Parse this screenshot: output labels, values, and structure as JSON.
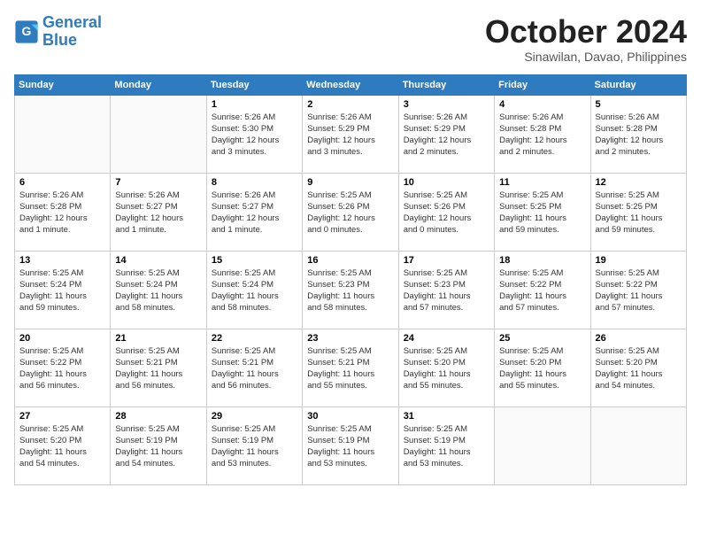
{
  "header": {
    "logo_line1": "General",
    "logo_line2": "Blue",
    "title": "October 2024",
    "location": "Sinawilan, Davao, Philippines"
  },
  "days_of_week": [
    "Sunday",
    "Monday",
    "Tuesday",
    "Wednesday",
    "Thursday",
    "Friday",
    "Saturday"
  ],
  "weeks": [
    [
      {
        "day": "",
        "info": ""
      },
      {
        "day": "",
        "info": ""
      },
      {
        "day": "1",
        "info": "Sunrise: 5:26 AM\nSunset: 5:30 PM\nDaylight: 12 hours\nand 3 minutes."
      },
      {
        "day": "2",
        "info": "Sunrise: 5:26 AM\nSunset: 5:29 PM\nDaylight: 12 hours\nand 3 minutes."
      },
      {
        "day": "3",
        "info": "Sunrise: 5:26 AM\nSunset: 5:29 PM\nDaylight: 12 hours\nand 2 minutes."
      },
      {
        "day": "4",
        "info": "Sunrise: 5:26 AM\nSunset: 5:28 PM\nDaylight: 12 hours\nand 2 minutes."
      },
      {
        "day": "5",
        "info": "Sunrise: 5:26 AM\nSunset: 5:28 PM\nDaylight: 12 hours\nand 2 minutes."
      }
    ],
    [
      {
        "day": "6",
        "info": "Sunrise: 5:26 AM\nSunset: 5:28 PM\nDaylight: 12 hours\nand 1 minute."
      },
      {
        "day": "7",
        "info": "Sunrise: 5:26 AM\nSunset: 5:27 PM\nDaylight: 12 hours\nand 1 minute."
      },
      {
        "day": "8",
        "info": "Sunrise: 5:26 AM\nSunset: 5:27 PM\nDaylight: 12 hours\nand 1 minute."
      },
      {
        "day": "9",
        "info": "Sunrise: 5:25 AM\nSunset: 5:26 PM\nDaylight: 12 hours\nand 0 minutes."
      },
      {
        "day": "10",
        "info": "Sunrise: 5:25 AM\nSunset: 5:26 PM\nDaylight: 12 hours\nand 0 minutes."
      },
      {
        "day": "11",
        "info": "Sunrise: 5:25 AM\nSunset: 5:25 PM\nDaylight: 11 hours\nand 59 minutes."
      },
      {
        "day": "12",
        "info": "Sunrise: 5:25 AM\nSunset: 5:25 PM\nDaylight: 11 hours\nand 59 minutes."
      }
    ],
    [
      {
        "day": "13",
        "info": "Sunrise: 5:25 AM\nSunset: 5:24 PM\nDaylight: 11 hours\nand 59 minutes."
      },
      {
        "day": "14",
        "info": "Sunrise: 5:25 AM\nSunset: 5:24 PM\nDaylight: 11 hours\nand 58 minutes."
      },
      {
        "day": "15",
        "info": "Sunrise: 5:25 AM\nSunset: 5:24 PM\nDaylight: 11 hours\nand 58 minutes."
      },
      {
        "day": "16",
        "info": "Sunrise: 5:25 AM\nSunset: 5:23 PM\nDaylight: 11 hours\nand 58 minutes."
      },
      {
        "day": "17",
        "info": "Sunrise: 5:25 AM\nSunset: 5:23 PM\nDaylight: 11 hours\nand 57 minutes."
      },
      {
        "day": "18",
        "info": "Sunrise: 5:25 AM\nSunset: 5:22 PM\nDaylight: 11 hours\nand 57 minutes."
      },
      {
        "day": "19",
        "info": "Sunrise: 5:25 AM\nSunset: 5:22 PM\nDaylight: 11 hours\nand 57 minutes."
      }
    ],
    [
      {
        "day": "20",
        "info": "Sunrise: 5:25 AM\nSunset: 5:22 PM\nDaylight: 11 hours\nand 56 minutes."
      },
      {
        "day": "21",
        "info": "Sunrise: 5:25 AM\nSunset: 5:21 PM\nDaylight: 11 hours\nand 56 minutes."
      },
      {
        "day": "22",
        "info": "Sunrise: 5:25 AM\nSunset: 5:21 PM\nDaylight: 11 hours\nand 56 minutes."
      },
      {
        "day": "23",
        "info": "Sunrise: 5:25 AM\nSunset: 5:21 PM\nDaylight: 11 hours\nand 55 minutes."
      },
      {
        "day": "24",
        "info": "Sunrise: 5:25 AM\nSunset: 5:20 PM\nDaylight: 11 hours\nand 55 minutes."
      },
      {
        "day": "25",
        "info": "Sunrise: 5:25 AM\nSunset: 5:20 PM\nDaylight: 11 hours\nand 55 minutes."
      },
      {
        "day": "26",
        "info": "Sunrise: 5:25 AM\nSunset: 5:20 PM\nDaylight: 11 hours\nand 54 minutes."
      }
    ],
    [
      {
        "day": "27",
        "info": "Sunrise: 5:25 AM\nSunset: 5:20 PM\nDaylight: 11 hours\nand 54 minutes."
      },
      {
        "day": "28",
        "info": "Sunrise: 5:25 AM\nSunset: 5:19 PM\nDaylight: 11 hours\nand 54 minutes."
      },
      {
        "day": "29",
        "info": "Sunrise: 5:25 AM\nSunset: 5:19 PM\nDaylight: 11 hours\nand 53 minutes."
      },
      {
        "day": "30",
        "info": "Sunrise: 5:25 AM\nSunset: 5:19 PM\nDaylight: 11 hours\nand 53 minutes."
      },
      {
        "day": "31",
        "info": "Sunrise: 5:25 AM\nSunset: 5:19 PM\nDaylight: 11 hours\nand 53 minutes."
      },
      {
        "day": "",
        "info": ""
      },
      {
        "day": "",
        "info": ""
      }
    ]
  ]
}
